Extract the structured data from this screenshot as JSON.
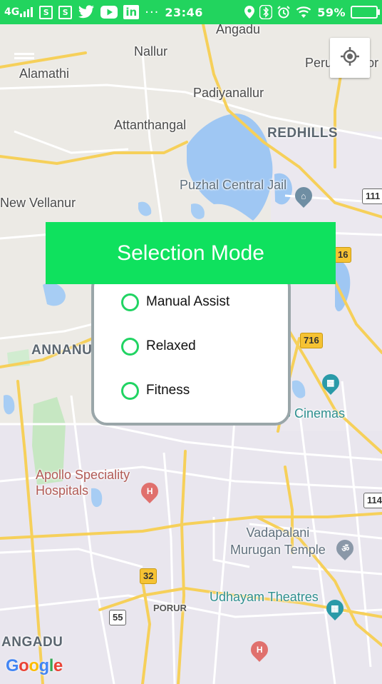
{
  "status_bar": {
    "network": "4G",
    "time": "23:46",
    "more_indicator": "···",
    "battery_percent": "59%",
    "background_color": "#22d45e",
    "left_icons": [
      "signal-icon",
      "sim-icon",
      "sim-icon",
      "twitter-icon",
      "youtube-icon",
      "linkedin-icon"
    ],
    "right_icons": [
      "location-icon",
      "bluetooth-icon",
      "alarm-icon",
      "wifi-icon",
      "battery-icon"
    ]
  },
  "map": {
    "places": [
      "Angadu",
      "Nallur",
      "Perungavoor",
      "Alamathi",
      "Padiyanallur",
      "Attanthangal",
      "New Vellanur"
    ],
    "areas": [
      "REDHILLS",
      "ANNANUR",
      "ANGADU"
    ],
    "pois": {
      "jail": "Puzhal Central Jail",
      "cinemas": "S Cinemas",
      "hospital": "Apollo Speciality\nHospitals",
      "temple": "Vadapalani\nMurugan Temple",
      "theatres": "Udhayam Theatres"
    },
    "small_area": "PORUR",
    "route_shields": [
      "111",
      "16",
      "716",
      "114",
      "32",
      "55"
    ],
    "attribution": "Google"
  },
  "dialog": {
    "title": "Selection Mode",
    "header_color": "#0fe15e",
    "options": [
      {
        "label": "Manual Assist",
        "selected": false
      },
      {
        "label": "Relaxed",
        "selected": false
      },
      {
        "label": "Fitness",
        "selected": false
      }
    ]
  },
  "locate_button": {
    "icon": "my-location-icon"
  }
}
